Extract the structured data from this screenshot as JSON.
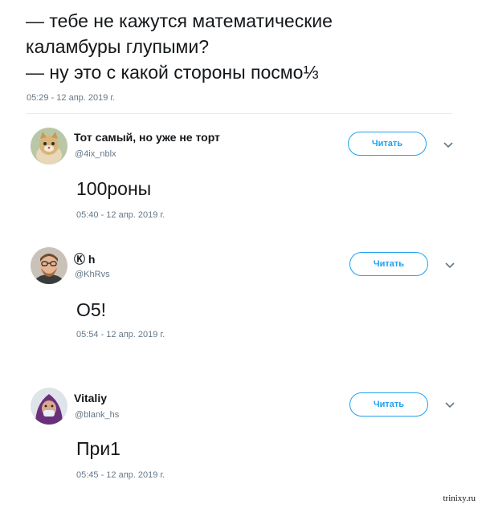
{
  "main_tweet": {
    "lines": [
      "— тебе не кажутся математические",
      "каламбуры глупыми?",
      "— ну это с какой стороны посмо⅓"
    ],
    "timestamp": "05:29 - 12 апр. 2019 г."
  },
  "replies": [
    {
      "name": "Тот самый, но уже не торт",
      "handle": "@4ix_nblx",
      "follow_label": "Читать",
      "text": "100роны",
      "timestamp": "05:40 - 12 апр. 2019 г.",
      "avatar_icon": "cat-avatar-icon"
    },
    {
      "name": "Ⓚ h",
      "handle": "@KhRvs",
      "follow_label": "Читать",
      "text": "O5!",
      "timestamp": "05:54 - 12 апр. 2019 г.",
      "avatar_icon": "man-avatar-icon"
    },
    {
      "name": "Vitaliy",
      "handle": "@blank_hs",
      "follow_label": "Читать",
      "text": "При1",
      "timestamp": "05:45 - 12 апр. 2019 г.",
      "avatar_icon": "hooded-avatar-icon"
    }
  ],
  "watermark": "trinixy.ru",
  "colors": {
    "accent": "#1da1f2",
    "muted": "#657786",
    "text": "#14171a"
  }
}
